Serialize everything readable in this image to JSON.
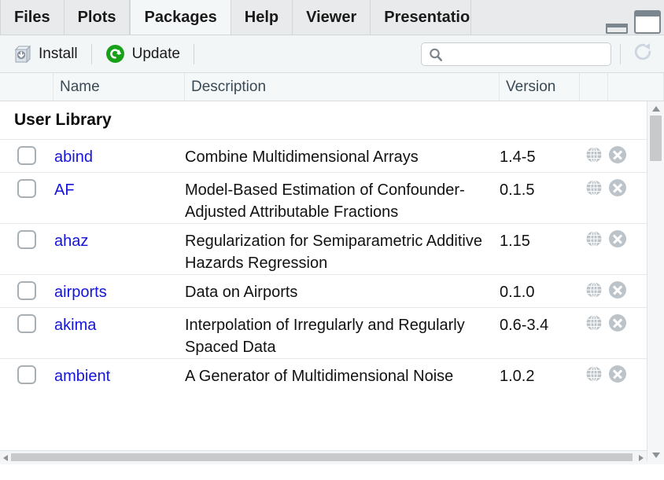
{
  "window": {
    "minimize_icon": "minimize-icon",
    "maximize_icon": "maximize-icon"
  },
  "tabs": [
    {
      "label": "Files",
      "active": false
    },
    {
      "label": "Plots",
      "active": false
    },
    {
      "label": "Packages",
      "active": true
    },
    {
      "label": "Help",
      "active": false
    },
    {
      "label": "Viewer",
      "active": false
    },
    {
      "label": "Presentatio",
      "active": false,
      "clipped": true
    }
  ],
  "toolbar": {
    "install_label": "Install",
    "install_icon": "install-package-icon",
    "update_label": "Update",
    "update_icon": "update-refresh-icon",
    "search_value": "",
    "search_placeholder": "",
    "search_icon": "search-icon",
    "refresh_icon": "refresh-icon"
  },
  "columns": [
    {
      "label": ""
    },
    {
      "label": "Name"
    },
    {
      "label": "Description"
    },
    {
      "label": "Version"
    },
    {
      "label": ""
    },
    {
      "label": ""
    }
  ],
  "library": {
    "title": "User Library"
  },
  "packages": [
    {
      "name": "abind",
      "description": "Combine Multidimensional Arrays",
      "version": "1.4-5",
      "checked": false,
      "browse_icon": "globe-icon",
      "remove_icon": "remove-circle-icon"
    },
    {
      "name": "AF",
      "description": "Model-Based Estimation of Confounder-Adjusted Attributable Fractions",
      "version": "0.1.5",
      "checked": false,
      "browse_icon": "globe-icon",
      "remove_icon": "remove-circle-icon"
    },
    {
      "name": "ahaz",
      "description": "Regularization for Semiparametric Additive Hazards Regression",
      "version": "1.15",
      "checked": false,
      "browse_icon": "globe-icon",
      "remove_icon": "remove-circle-icon"
    },
    {
      "name": "airports",
      "description": "Data on Airports",
      "version": "0.1.0",
      "checked": false,
      "browse_icon": "globe-icon",
      "remove_icon": "remove-circle-icon"
    },
    {
      "name": "akima",
      "description": "Interpolation of Irregularly and Regularly Spaced Data",
      "version": "0.6-3.4",
      "checked": false,
      "browse_icon": "globe-icon",
      "remove_icon": "remove-circle-icon"
    },
    {
      "name": "ambient",
      "description": "A Generator of Multidimensional Noise",
      "version": "1.0.2",
      "checked": false,
      "browse_icon": "globe-icon",
      "remove_icon": "remove-circle-icon"
    }
  ],
  "colors": {
    "link": "#1414dd",
    "update_green": "#18a019",
    "tabbar_bg": "#e9eaeb",
    "toolbar_bg": "#f2f6f7",
    "icon_gray": "#bcc4c9"
  }
}
